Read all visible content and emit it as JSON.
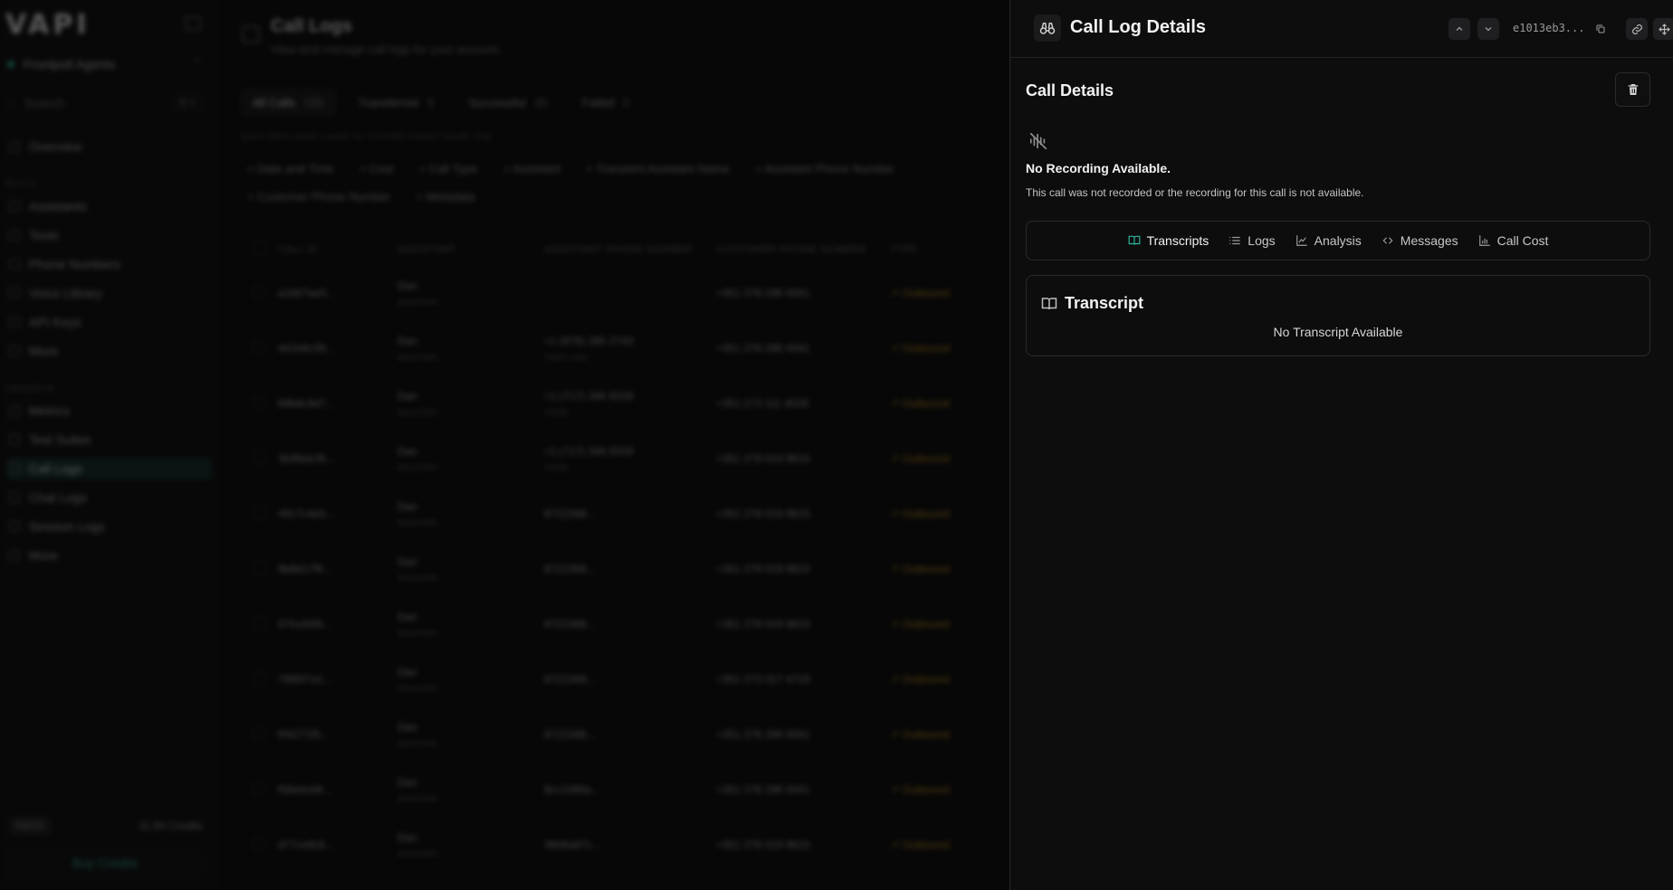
{
  "app": {
    "logo": "VAPI"
  },
  "sidebar": {
    "org_name": "Frontpoll Agents",
    "search_placeholder": "Search",
    "search_shortcut": "⌘ K",
    "overview": "Overview",
    "build_section": "BUILD",
    "build_items": [
      "Assistants",
      "Tools",
      "Phone Numbers",
      "Voice Library",
      "API Keys",
      "More"
    ],
    "observe_section": "OBSERVE",
    "observe_items": [
      "Metrics",
      "Test Suites",
      "Call Logs",
      "Chat Logs",
      "Session Logs",
      "More"
    ],
    "active_item": "Call Logs",
    "plan": "PAYG",
    "credits": "11.84 Credits",
    "buy_credits": "Buy Credits"
  },
  "main": {
    "title": "Call Logs",
    "subtitle": "View and manage call logs for your account.",
    "filter_tabs": [
      {
        "label": "All Calls",
        "count": "150"
      },
      {
        "label": "Transferred",
        "count": "0"
      },
      {
        "label": "Successful",
        "count": "35"
      },
      {
        "label": "Failed",
        "count": "0"
      }
    ],
    "hint": "Quick filters show counts for currently loaded results only.",
    "column_filters": [
      "Date and Time",
      "Cost",
      "Call Type",
      "Assistant",
      "Transient Assistant Name",
      "Assistant Phone Number",
      "Customer Phone Number",
      "Metadata"
    ],
    "columns": [
      "CALL ID",
      "ASSISTANT",
      "ASSISTANT PHONE NUMBER",
      "CUSTOMER PHONE NUMBER",
      "TYPE"
    ],
    "rows": [
      {
        "id": "a1b67ae5...",
        "assistant": "Dan",
        "assistant_sub": "dca1c0e9...",
        "asst_phone": "",
        "asst_phone_sub": "",
        "cust_phone": "+351 278 296 0041",
        "type": "Outbound"
      },
      {
        "id": "4d1b6c39...",
        "assistant": "Dan",
        "assistant_sub": "dca1c0e9...",
        "asst_phone": "+1 (978) 285 2743",
        "asst_phone_sub": "Twilio main",
        "cust_phone": "+351 278 296 0041",
        "type": "Outbound"
      },
      {
        "id": "69b8c9d7...",
        "assistant": "Dan",
        "assistant_sub": "dca1c0e9...",
        "asst_phone": "+1 (717) 346 9329",
        "asst_phone_sub": "Vonify",
        "cust_phone": "+351 273 111 4528",
        "type": "Outbound"
      },
      {
        "id": "3b99de35...",
        "assistant": "Dan",
        "assistant_sub": "dca1c0e9...",
        "asst_phone": "+1 (717) 346 9329",
        "asst_phone_sub": "Vonify",
        "cust_phone": "+351 278 019 9615",
        "type": "Outbound"
      },
      {
        "id": "4917c4e5...",
        "assistant": "Dan",
        "assistant_sub": "dca1c0e9...",
        "asst_phone": "8721568...",
        "asst_phone_sub": "",
        "cust_phone": "+351 278 019 9615",
        "type": "Outbound"
      },
      {
        "id": "9b8d17f6...",
        "assistant": "Dan",
        "assistant_sub": "dca1c0e9...",
        "asst_phone": "8721568...",
        "asst_phone_sub": "",
        "cust_phone": "+351 278 019 9615",
        "type": "Outbound"
      },
      {
        "id": "67fce939...",
        "assistant": "Dan",
        "assistant_sub": "dca1c0e9...",
        "asst_phone": "8721568...",
        "asst_phone_sub": "",
        "cust_phone": "+351 278 019 9615",
        "type": "Outbound"
      },
      {
        "id": "7965f7e1...",
        "assistant": "Dan",
        "assistant_sub": "dca1c0e9...",
        "asst_phone": "8721568...",
        "asst_phone_sub": "",
        "cust_phone": "+351 273 017 4729",
        "type": "Outbound"
      },
      {
        "id": "f04271f5...",
        "assistant": "Dan",
        "assistant_sub": "dca1c0e9...",
        "asst_phone": "8721568...",
        "asst_phone_sub": "",
        "cust_phone": "+351 278 296 0041",
        "type": "Outbound"
      },
      {
        "id": "f58ebcb8...",
        "assistant": "Dan",
        "assistant_sub": "dca1c0e9...",
        "asst_phone": "8cc1086a...",
        "asst_phone_sub": "",
        "cust_phone": "+351 278 296 0041",
        "type": "Outbound"
      },
      {
        "id": "d77ce9c6...",
        "assistant": "Dan",
        "assistant_sub": "dca1c0e9...",
        "asst_phone": "3806a97c...",
        "asst_phone_sub": "",
        "cust_phone": "+351 278 019 9615",
        "type": "Outbound"
      }
    ]
  },
  "panel": {
    "title": "Call Log Details",
    "call_id": "e1013eb3...",
    "section_title": "Call Details",
    "no_recording_title": "No Recording Available.",
    "no_recording_desc": "This call was not recorded or the recording for this call is not available.",
    "tabs": [
      "Transcripts",
      "Logs",
      "Analysis",
      "Messages",
      "Call Cost"
    ],
    "active_tab": "Transcripts",
    "transcript_title": "Transcript",
    "transcript_empty": "No Transcript Available"
  },
  "colors": {
    "accent": "#2fb39b",
    "panel_bg": "#0d0d0e",
    "border": "#2a2a2c",
    "outbound": "#d9a520"
  },
  "icons": {
    "panel_header": "binoculars-icon",
    "no_recording": "audio-off-icon",
    "delete": "trash-icon",
    "transcripts": "book-open-icon",
    "logs": "list-icon",
    "analysis": "line-chart-icon",
    "messages": "code-icon",
    "call_cost": "bar-chart-icon"
  }
}
